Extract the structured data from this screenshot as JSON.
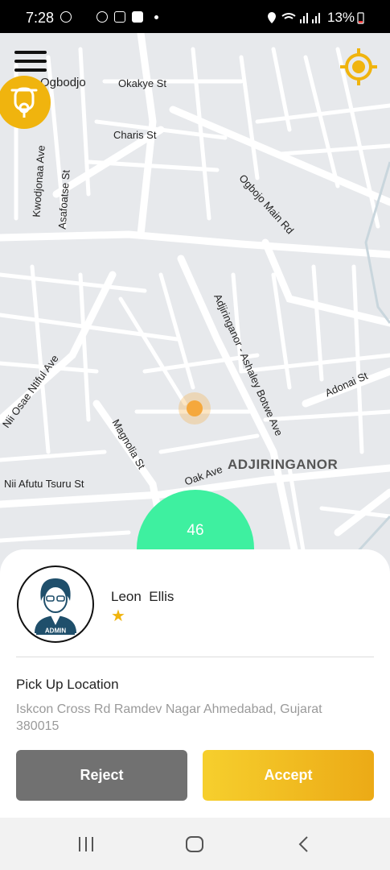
{
  "status_bar": {
    "time": "7:28",
    "notification_icons": [
      "whatsapp-icon",
      "b-icon",
      "app-icon",
      "p-icon"
    ],
    "battery": "13%"
  },
  "map": {
    "streets": [
      {
        "name": "Okakye St"
      },
      {
        "name": "Charis St"
      },
      {
        "name": "Ogbodjo"
      },
      {
        "name": "Kwodjonaa Ave"
      },
      {
        "name": "Asafoatse St"
      },
      {
        "name": "Ogbojo Main Rd"
      },
      {
        "name": "Adjiringanor - Ashaley Botwe Ave"
      },
      {
        "name": "Adonai St"
      },
      {
        "name": "Nii Osae Ntiful Ave"
      },
      {
        "name": "Magnolia St"
      },
      {
        "name": "Oak Ave"
      },
      {
        "name": "Nii Afutu Tsuru St"
      }
    ],
    "area_label": "ADJIRINGANOR",
    "timer": "46"
  },
  "rider": {
    "avatar_badge": "ADMIN",
    "name": "Leon  Ellis",
    "rating_stars": "★"
  },
  "pickup": {
    "title": "Pick Up Location",
    "address": "Iskcon Cross Rd Ramdev Nagar Ahmedabad, Gujarat 380015"
  },
  "actions": {
    "reject_label": "Reject",
    "accept_label": "Accept"
  },
  "colors": {
    "accent": "#f0b40e",
    "timer": "#3ef0a0",
    "reject": "#717171"
  }
}
